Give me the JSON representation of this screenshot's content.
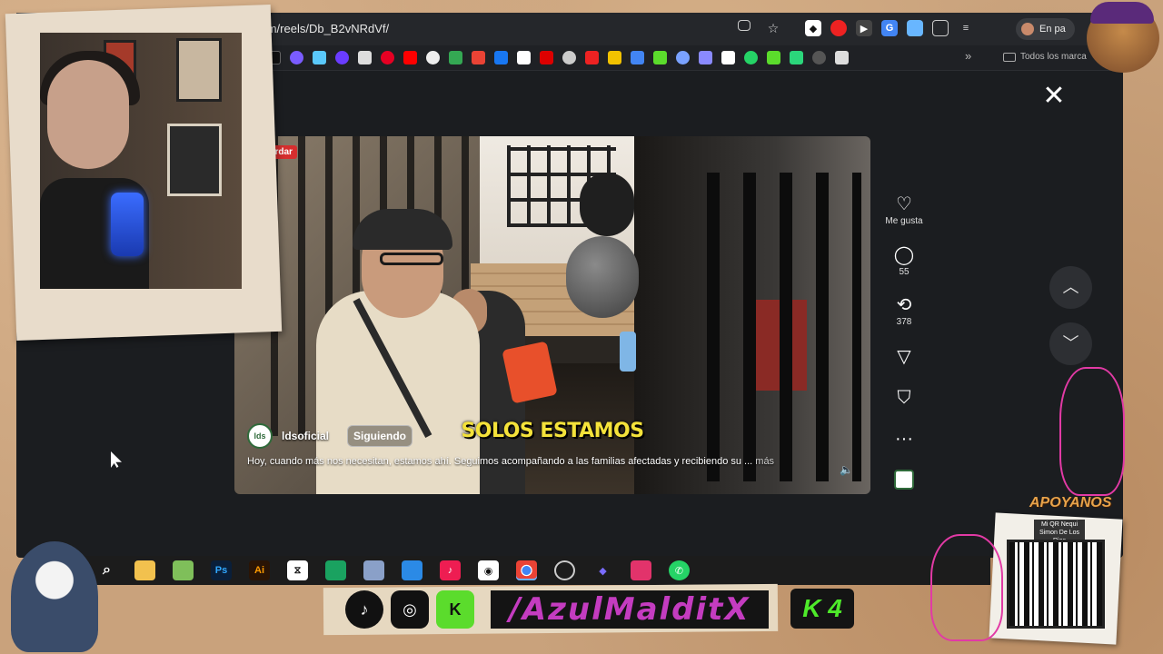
{
  "browser": {
    "url": "com/reels/Db_B2vNRdVf/",
    "profile_label": "En pa",
    "bookmarks_folder": "Todos los marca"
  },
  "reel": {
    "save_badge": "Guardar",
    "subtitle": "SOLOS ESTAMOS",
    "author": "ldsoficial",
    "follow_label": "Siguiendo",
    "caption": "Hoy, cuando más nos necesitan, estamos ahí. Seguimos acompañando a las familias afectadas y recibiendo su ...",
    "caption_more": "más"
  },
  "actions": {
    "like_label": "Me gusta",
    "comment_count": "55",
    "repost_count": "378"
  },
  "overlay": {
    "handle": "/AzulMalditX",
    "k4": "K 4",
    "apoyanos": "APOYANOS",
    "qr_label": "Mi QR Nequi Simon De Los Rios"
  },
  "colors": {
    "screen_bg": "#1b1d20",
    "subtitle_yellow": "#f4e23a",
    "handle_purple": "#c43cc0",
    "k4_green": "#4eea2a"
  }
}
